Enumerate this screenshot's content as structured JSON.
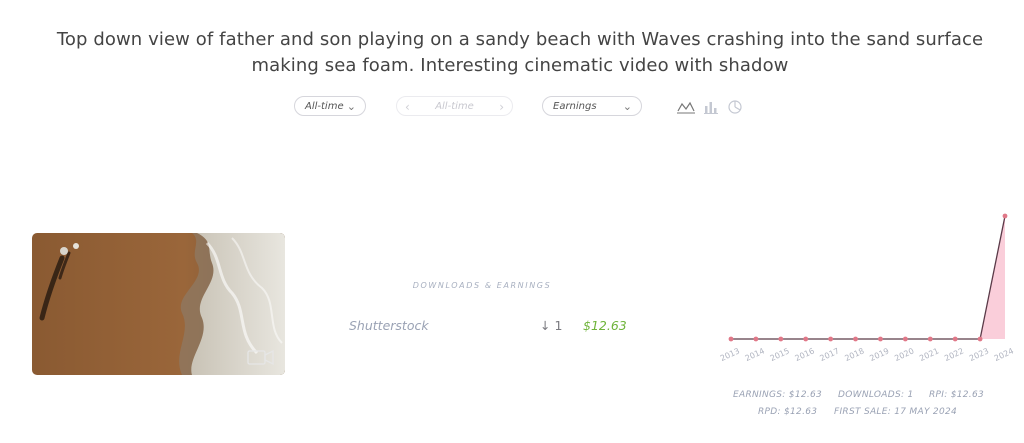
{
  "title": "Top down view of father and son playing on a sandy beach with Waves crashing into the sand surface making sea foam. Interesting cinematic video with shadow",
  "filters": {
    "period": "All-time",
    "range": "All-time",
    "metric": "Earnings"
  },
  "chart_type_icons": [
    "line-chart-icon",
    "bar-chart-icon",
    "pie-chart-icon"
  ],
  "thumbnail": {
    "media_icon": "video-camera-icon"
  },
  "downloads_section": {
    "heading": "DOWNLOADS & EARNINGS",
    "rows": [
      {
        "source": "Shutterstock",
        "downloads": "1",
        "earnings": "$12.63"
      }
    ]
  },
  "stats": {
    "earnings": "EARNINGS: $12.63",
    "downloads": "DOWNLOADS: 1",
    "rpi": "RPI: $12.63",
    "rpd": "RPD: $12.63",
    "first_sale": "FIRST SALE: 17 MAY 2024"
  },
  "colors": {
    "accent_green": "#6fb43a",
    "chart_line": "#5a3a48",
    "chart_fill": "#f9c6d3",
    "point": "#e07888"
  },
  "chart_data": {
    "type": "area",
    "x": [
      "2013",
      "2014",
      "2015",
      "2016",
      "2017",
      "2018",
      "2019",
      "2020",
      "2021",
      "2022",
      "2023",
      "2024"
    ],
    "values": [
      0,
      0,
      0,
      0,
      0,
      0,
      0,
      0,
      0,
      0,
      0,
      12.63
    ],
    "title": "",
    "xlabel": "",
    "ylabel": "",
    "ylim": [
      0,
      12.63
    ],
    "grid": false,
    "legend": "none"
  }
}
